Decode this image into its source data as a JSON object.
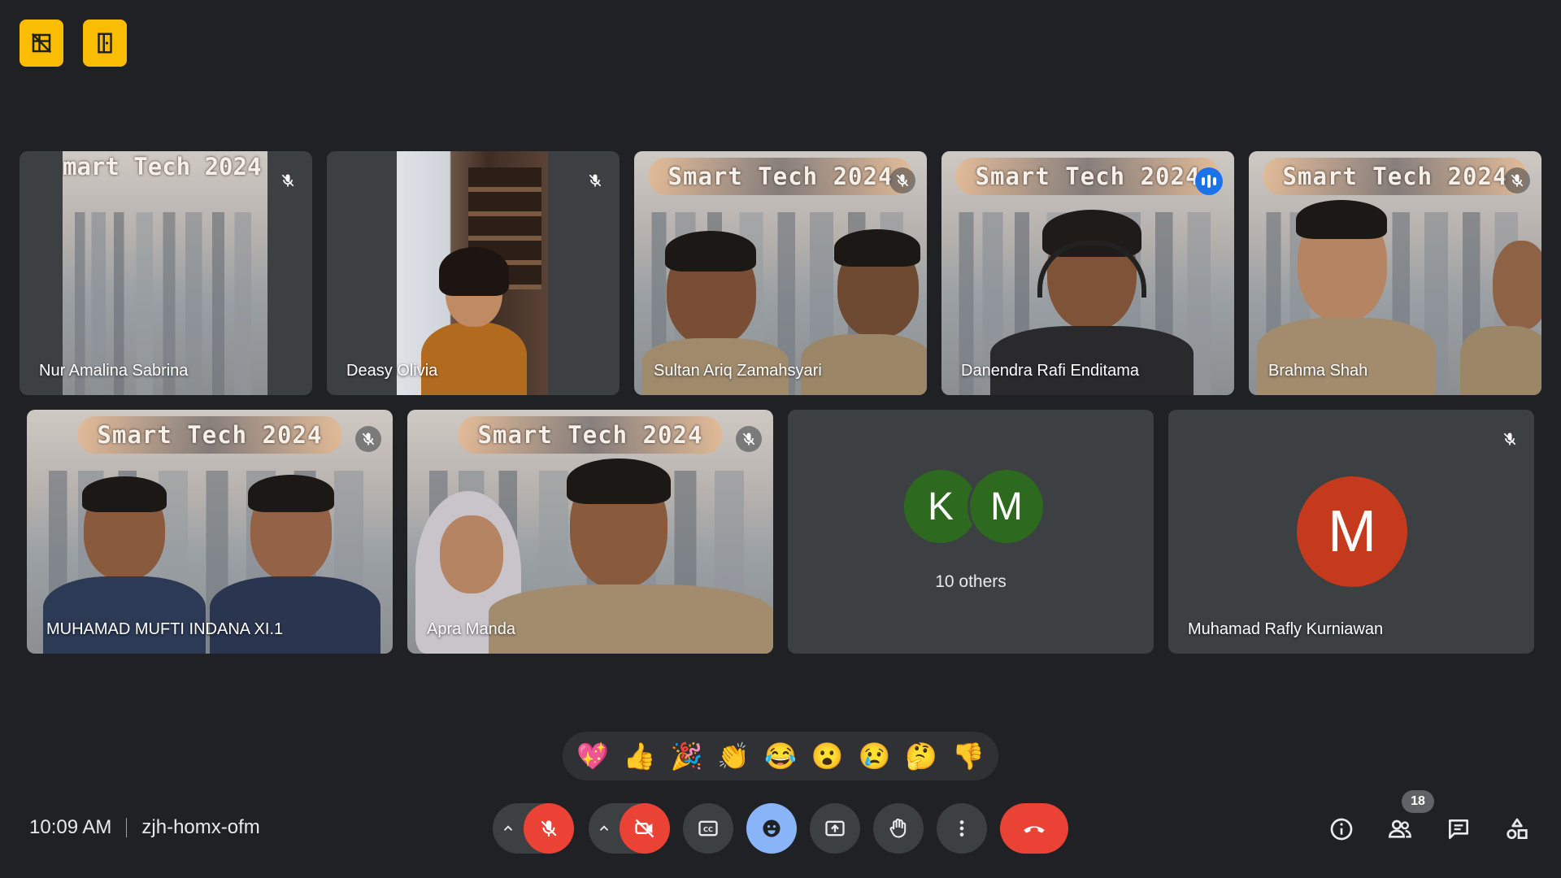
{
  "top_badges": [
    {
      "icon": "no-video-grid-icon"
    },
    {
      "icon": "door-exit-icon"
    }
  ],
  "banner_text": "Smart Tech 2024",
  "banner_text_cropped": "mart Tech 2024",
  "tiles": [
    {
      "name": "Nur Amalina Sabrina",
      "muted": true
    },
    {
      "name": "Deasy Olivia",
      "muted": true
    },
    {
      "name": "Sultan Ariq Zamahsyari",
      "muted": true
    },
    {
      "name": "Danendra Rafi Enditama",
      "speaking": true
    },
    {
      "name": "Brahma Shah",
      "muted": true
    },
    {
      "name": "MUHAMAD MUFTI INDANA XI.1",
      "muted": true
    },
    {
      "name": "Apra Manda",
      "muted": true
    },
    {
      "name": "Muhamad Rafly Kurniawan",
      "muted": true,
      "initial": "M",
      "avatar_color": "#c5391c"
    }
  ],
  "others": {
    "avatars": [
      {
        "initial": "K",
        "color": "#2d6a1f"
      },
      {
        "initial": "M",
        "color": "#2d6a1f"
      }
    ],
    "label": "10 others"
  },
  "reactions": [
    "💖",
    "👍",
    "🎉",
    "👏",
    "😂",
    "😮",
    "😢",
    "🤔",
    "👎"
  ],
  "meeting": {
    "time": "10:09 AM",
    "code": "zjh-homx-ofm"
  },
  "controls": {
    "participants_count": "18",
    "icons": [
      "mic-off-icon",
      "camera-off-icon",
      "captions-icon",
      "emoji-icon",
      "present-screen-icon",
      "raise-hand-icon",
      "more-options-icon",
      "hang-up-icon"
    ],
    "right_icons": [
      "info-icon",
      "people-icon",
      "chat-icon",
      "activities-icon"
    ]
  },
  "colors": {
    "background": "#202124",
    "badge_yellow": "#fbbc04",
    "danger_red": "#ea4335",
    "accent_blue": "#8ab4f8",
    "speaking_blue": "#1a73e8"
  }
}
